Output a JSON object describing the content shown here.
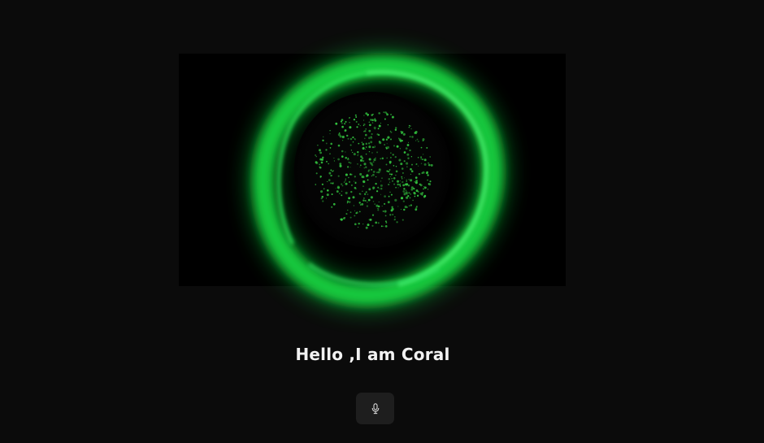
{
  "greeting": {
    "text": "Hello ,I am Coral"
  },
  "mic_button": {
    "icon": "microphone-icon"
  },
  "orb": {
    "ring_color": "#1fdc47",
    "ring_glow_color": "#0bd638",
    "particle_color": "#33c43f",
    "core_color": "#050505"
  },
  "colors": {
    "page_background": "#0b0b0b",
    "panel_background": "#000000",
    "button_background": "#1e1e1e",
    "text": "#f2f2f2"
  }
}
